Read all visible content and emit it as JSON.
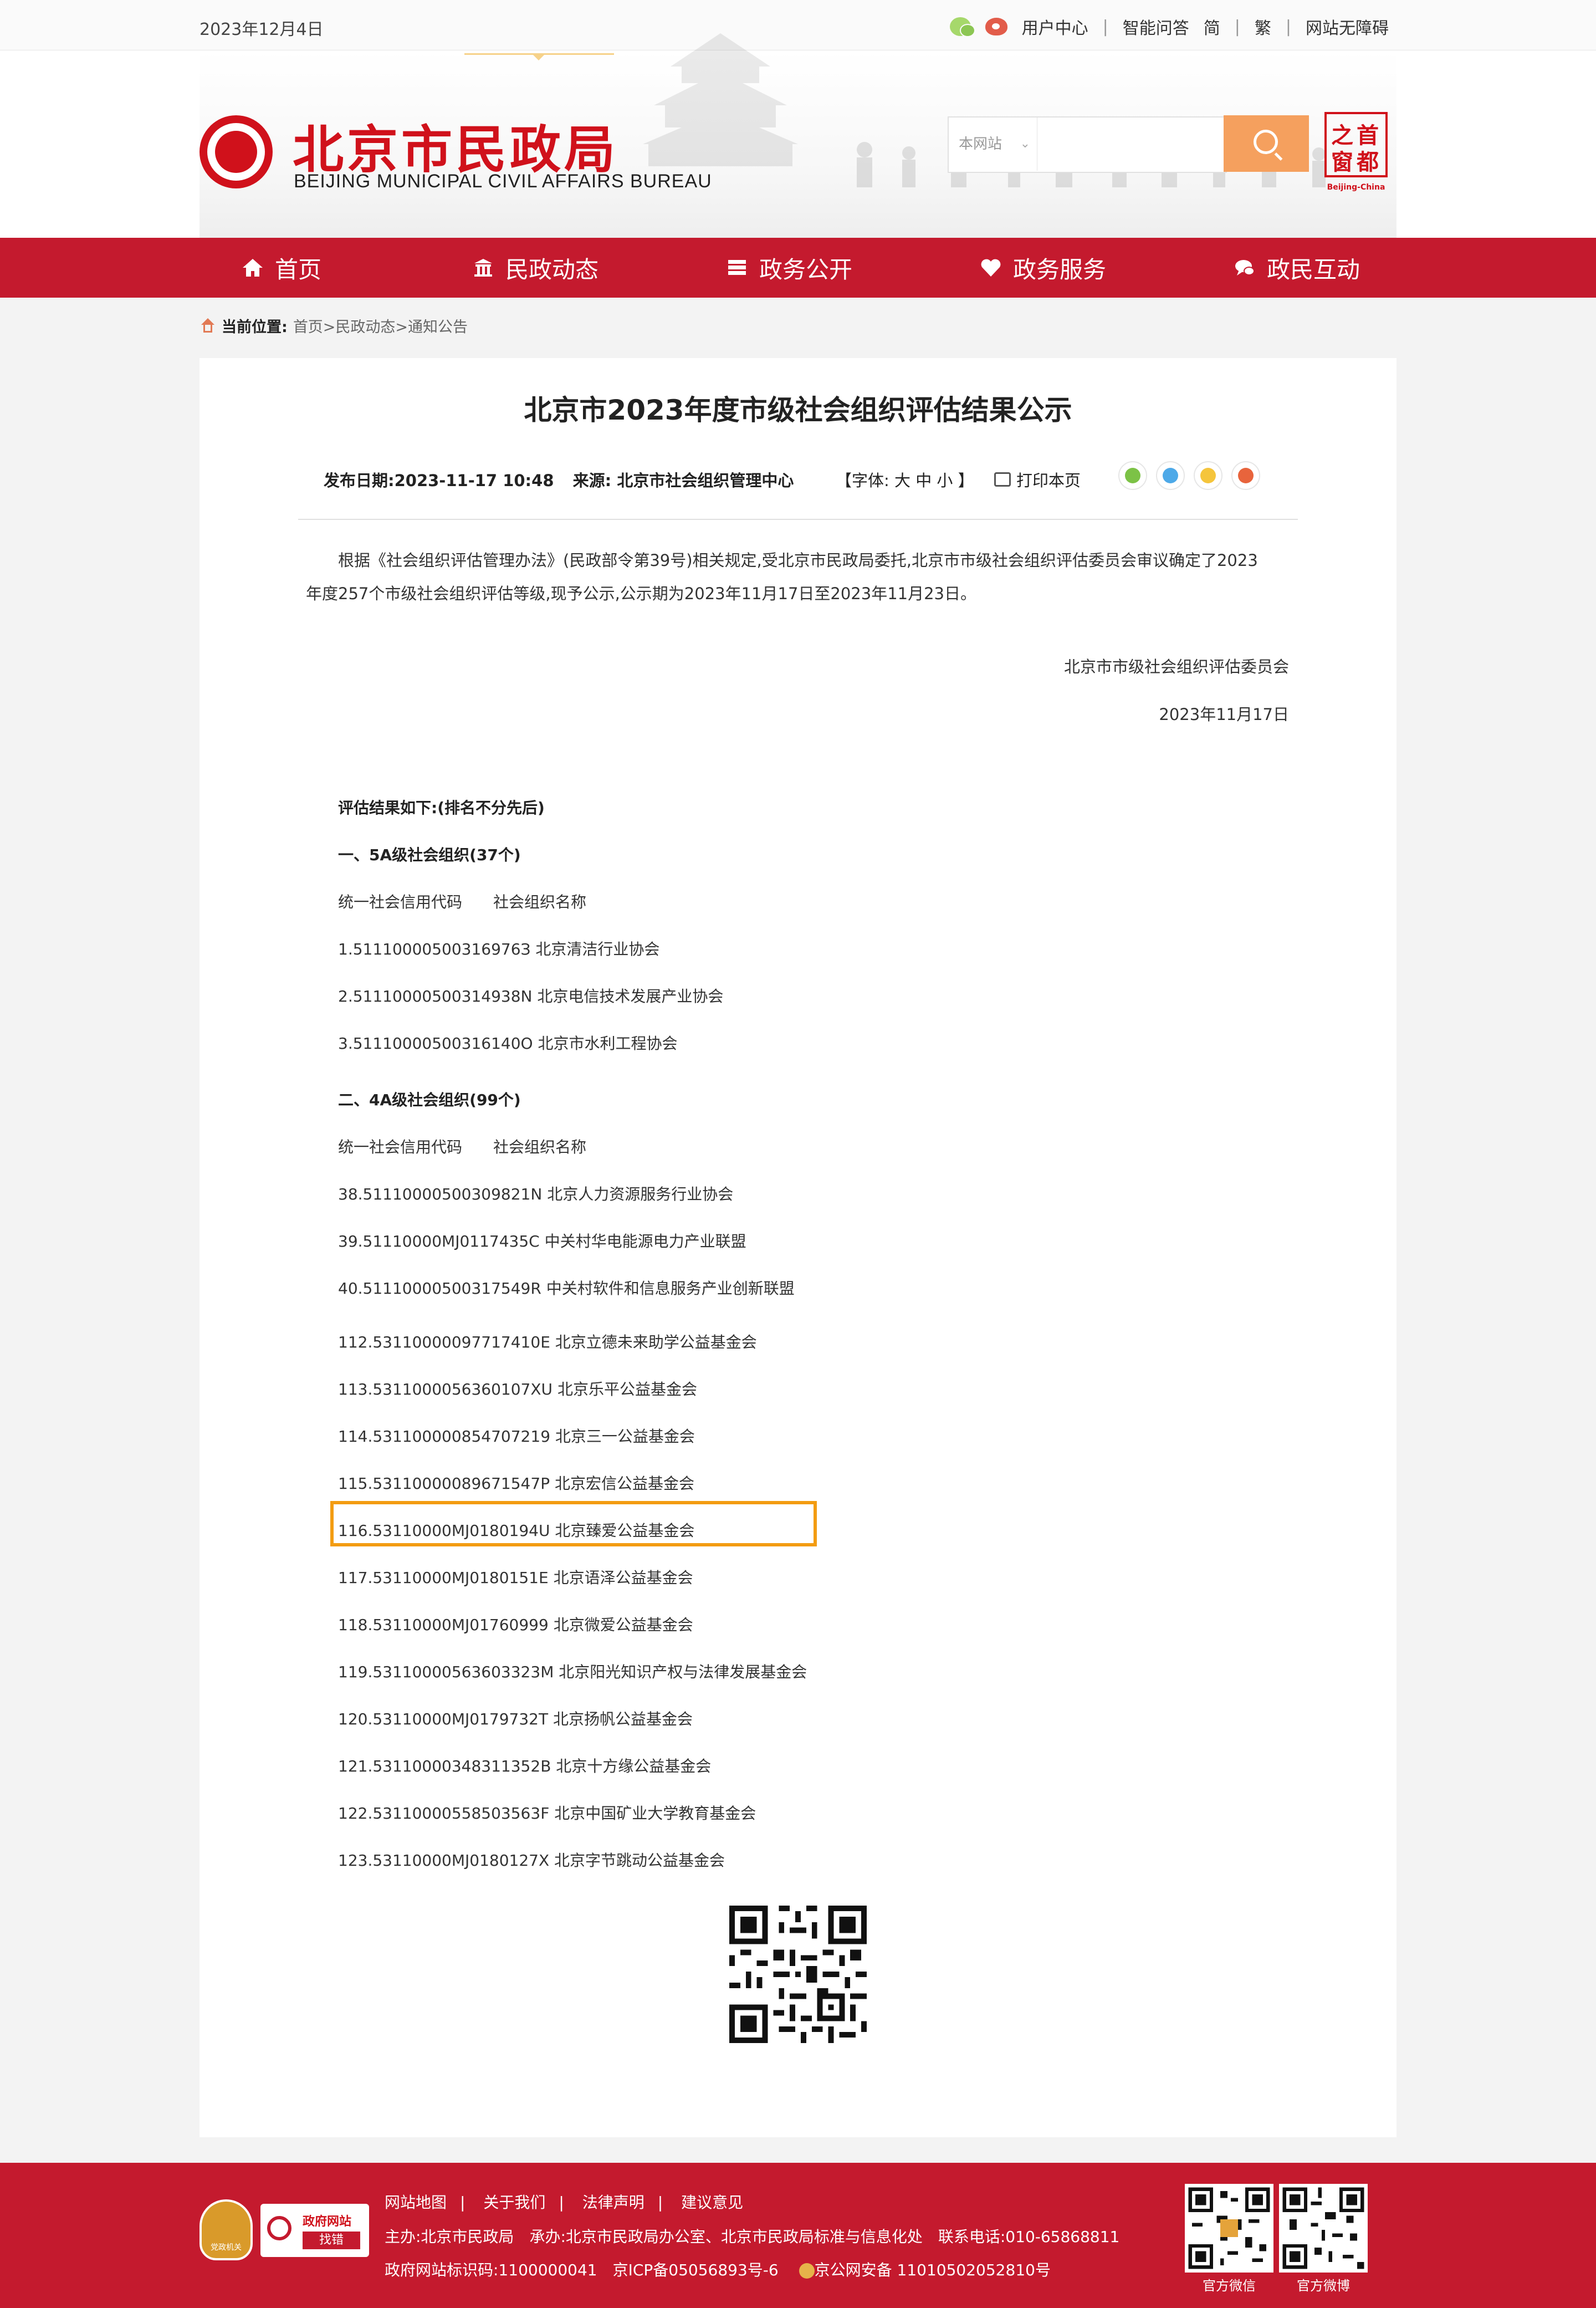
{
  "topbar": {
    "date": "2023年12月4日",
    "links": [
      "用户中心",
      "智能问答",
      "简",
      "繁",
      "网站无障碍"
    ],
    "icons": [
      "wechat-icon",
      "weibo-icon"
    ]
  },
  "header": {
    "logo_cn": "北京市民政局",
    "logo_en": "BEIJING MUNICIPAL CIVIL AFFAIRS BUREAU",
    "search_scope": "本网站",
    "capital_logo": {
      "chars": [
        "首",
        "都",
        "之",
        "窗"
      ],
      "en": "Beijing-China"
    }
  },
  "nav": {
    "items": [
      {
        "label": "首页",
        "icon": "home-icon"
      },
      {
        "label": "民政动态",
        "icon": "building-icon",
        "active": true
      },
      {
        "label": "政务公开",
        "icon": "stack-icon"
      },
      {
        "label": "政务服务",
        "icon": "heart-icon"
      },
      {
        "label": "政民互动",
        "icon": "chat-icon"
      }
    ]
  },
  "breadcrumb": {
    "label": "当前位置:",
    "path": "首页>民政动态>通知公告"
  },
  "article": {
    "title": "北京市2023年度市级社会组织评估结果公示",
    "publish_date": "发布日期:2023-11-17 10:48",
    "source": "来源: 北京市社会组织管理中心",
    "font_size": "【字体: 大 中 小 】",
    "print": "打印本页",
    "intro_1": "根据《社会组织评估管理办法》(民政部令第39号)相关规定,受北京市民政局委托,北京市市级社会组织评估委员会审议确定了2023",
    "intro_2": "年度257个市级社会组织评估等级,现予公示,公示期为2023年11月17日至2023年11月23日。",
    "signer": "北京市市级社会组织评估委员会",
    "sign_date": "2023年11月17日",
    "results_heading": "评估结果如下:(排名不分先后)",
    "section_5a": "一、5A级社会组织(37个)",
    "header_5a": "统一社会信用代码　　社会组织名称",
    "items_5a": [
      "1.51110000500316976З  北京清洁行业协会",
      "2.51110000500314938N  北京电信技术发展产业协会",
      "3.51110000500316140O  北京市水利工程协会"
    ],
    "section_4a": "二、4A级社会组织(99个)",
    "header_4a": "统一社会信用代码　　社会组织名称",
    "items_4a_a": [
      "38.51110000500309821N  北京人力资源服务行业协会",
      "39.51110000MJ0117435C  中关村华电能源电力产业联盟",
      "40.51110000500317549R  中关村软件和信息服务产业创新联盟"
    ],
    "items_4a_b": [
      "112.53110000097717410E  北京立德未来助学公益基金会",
      "113.5311000056360107XU  北京乐平公益基金会",
      "114.531100000854707219  北京三一公益基金会",
      "115.53110000089671547P  北京宏信公益基金会",
      "116.53110000MJ0180194U  北京臻爱公益基金会",
      "117.53110000MJ0180151E  北京语泽公益基金会",
      "118.53110000MJ01760999  北京微爱公益基金会",
      "119.53110000563603323M  北京阳光知识产权与法律发展基金会",
      "120.53110000MJ0179732T  北京扬帆公益基金会",
      "121.53110000348311352B  北京十方缘公益基金会",
      "122.53110000558503563F  北京中国矿业大学教育基金会",
      "123.53110000MJ0180127X  北京字节跳动公益基金会"
    ]
  },
  "footer": {
    "badge_text": "党政机关",
    "find_title": "政府网站",
    "find_btn": "找错",
    "links": [
      "网站地图",
      "关于我们",
      "法律声明",
      "建议意见"
    ],
    "host": "主办:北京市民政局",
    "undertake": "承办:北京市民政局办公室、北京市民政局标准与信息化处",
    "phone": "联系电话:010-65868811",
    "site_id": "政府网站标识码:1100000041",
    "icp": "京ICP备05056893号-6",
    "police": "京公网安备 11010502052810号",
    "qr_labels": [
      "官方微信",
      "官方微博"
    ]
  },
  "colors": {
    "brand_red": "#c41a2e",
    "search_orange": "#f5a05e",
    "highlight_orange": "#f39c12"
  }
}
